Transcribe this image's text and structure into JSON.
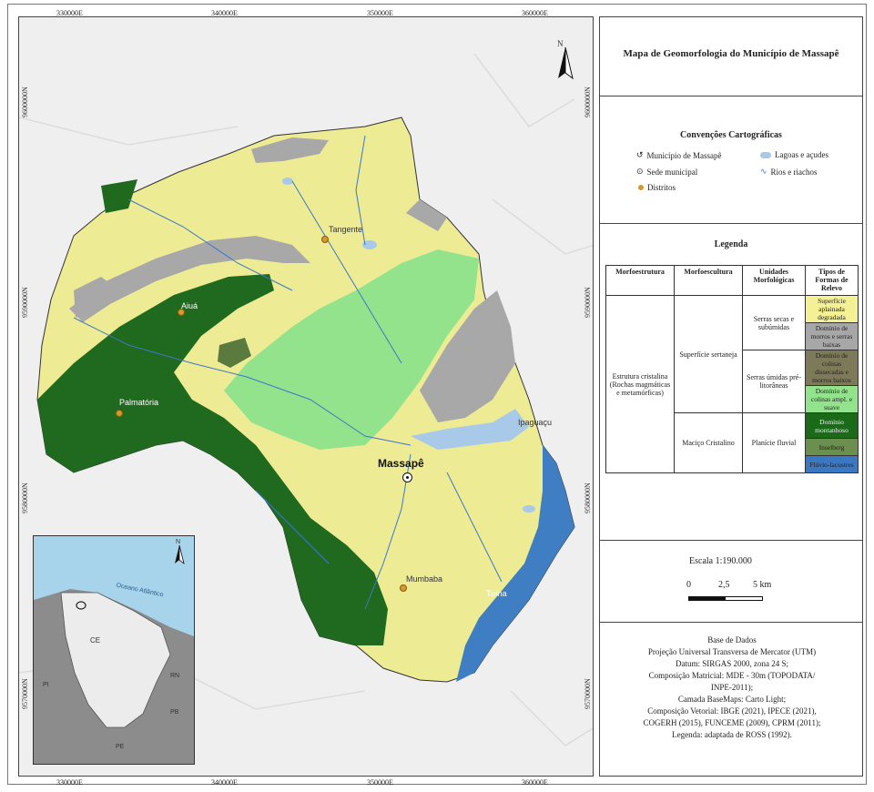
{
  "map": {
    "x_ticks_top": [
      "330000E",
      "340000E",
      "350000E",
      "360000E"
    ],
    "x_ticks_bottom": [
      "330000E",
      "340000E",
      "350000E",
      "360000E"
    ],
    "y_ticks_left": [
      "9600000N",
      "9590000N",
      "9580000N",
      "9570000N"
    ],
    "y_ticks_right": [
      "9600000N",
      "9590000N",
      "9580000N",
      "9570000N"
    ],
    "north_label": "N",
    "places": {
      "tangente": "Tangente",
      "aiua": "Aiuá",
      "palmatoria": "Palmatória",
      "massape": "Massapê",
      "ipaguacu": "Ipaguaçu",
      "mumbaba": "Mumbaba",
      "tuina": "Tuína"
    },
    "inset": {
      "ocean_label": "Oceano Atlântico",
      "state_ce": "CE",
      "state_pi": "PI",
      "state_rn": "RN",
      "state_pb": "PB",
      "state_pe": "PE",
      "north_label": "N"
    },
    "colors": {
      "yellow": "#eeeb95",
      "gray": "#a8a8a8",
      "dark_green": "#1f6a1f",
      "light_green": "#93e38d",
      "olive": "#5a7a3e",
      "blue": "#3f7ec2",
      "lake": "#a9c9e8",
      "river": "#3c78c8"
    }
  },
  "panel": {
    "title": "Mapa de Geomorfologia do Município de Massapê",
    "conventions_title": "Convenções Cartográficas",
    "conventions": {
      "municipio": "Município de Massapê",
      "lagoas": "Lagoas e açudes",
      "sede": "Sede municipal",
      "rios": "Rios e riachos",
      "distritos": "Distritos"
    },
    "legend_title": "Legenda",
    "legend_headers": [
      "Morfoestrutura",
      "Morfoescultura",
      "Unidades Morfológicas",
      "Tipos de Formas de Relevo"
    ],
    "legend_cells": {
      "morfoestrutura": "Estrutura cristalina (Rochas magmáticas e metamórficas)",
      "morfoescultura_1": "Superfície sertaneja",
      "morfoescultura_2": "Maciço Cristalino",
      "unidade_1": "Serras secas e subúmidas",
      "unidade_2": "Serras úmidas pré-litorâneas",
      "unidade_3": "Planície fluvial"
    },
    "legend_types": [
      {
        "label": "Superfície aplainada degradada",
        "color": "#f4f094"
      },
      {
        "label": "Domínio de morros e serras baixas",
        "color": "#a7a7a7"
      },
      {
        "label": "Domínio de colinas dissecadas e morros baixos",
        "color": "#7d7a5a"
      },
      {
        "label": "Domínio de colinas ampl. e suave",
        "color": "#93e38d"
      },
      {
        "label": "Domínio montanhoso",
        "color": "#1a6a1a"
      },
      {
        "label": "Inselberg",
        "color": "#6b8f4e"
      },
      {
        "label": "Flúvio-lacustres",
        "color": "#3b78c4"
      }
    ],
    "scale_title": "Escala 1:190.000",
    "scale_labels": [
      "0",
      "2,5",
      "5 km"
    ],
    "credits": [
      "Base de Dados",
      "Projeção Universal Transversa de Mercator (UTM)",
      "Datum: SIRGAS 2000, zona 24 S;",
      "Composição Matricial: MDE - 30m (TOPODATA/",
      "INPE-2011);",
      "Camada BaseMaps: Carto Light;",
      "Composição Vetorial: IBGE (2021), IPECE (2021),",
      "COGERH (2015), FUNCEME (2009), CPRM (2011);",
      "Legenda: adaptada de ROSS (1992)."
    ]
  }
}
